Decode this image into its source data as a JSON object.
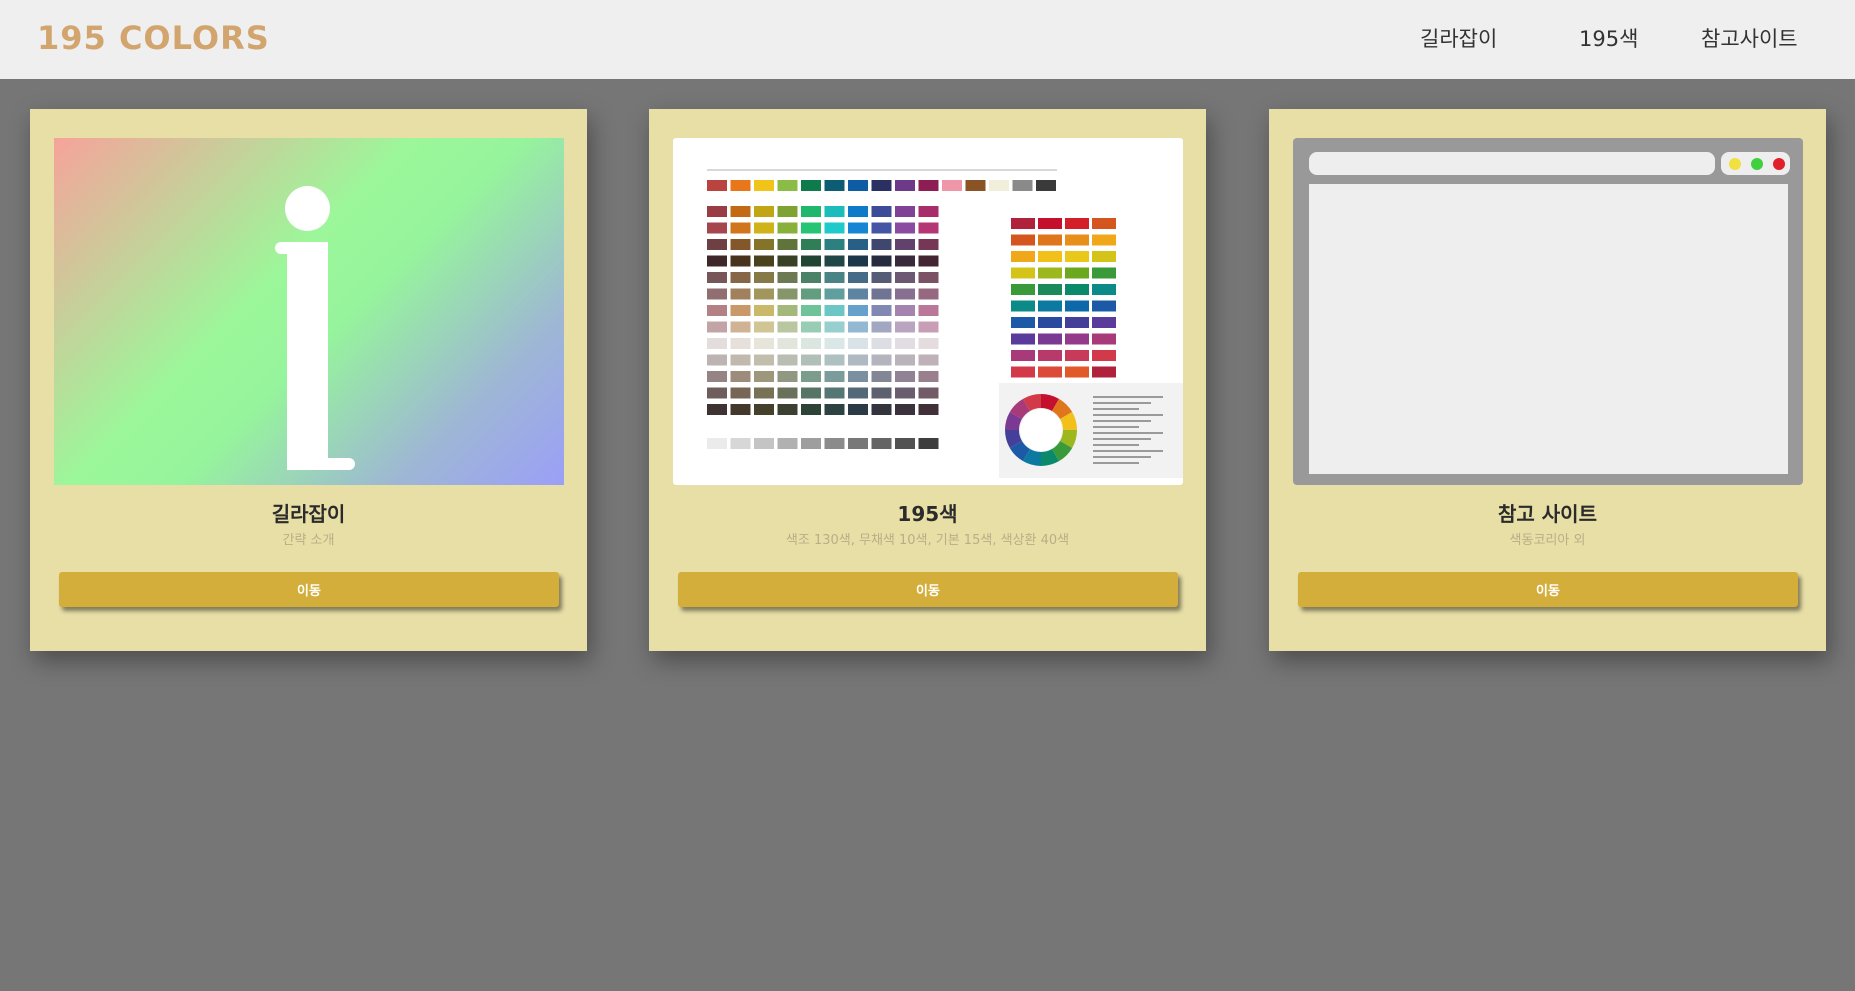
{
  "header": {
    "brand": "195 COLORS",
    "nav": [
      "길라잡이",
      "195색",
      "참고사이트"
    ]
  },
  "cards": [
    {
      "title": "길라잡이",
      "subtitle": "간략 소개",
      "button": "이동",
      "thumb": "info-icon"
    },
    {
      "title": "195색",
      "subtitle": "색조 130색, 무채색 10색, 기본 15색, 색상환 40색",
      "button": "이동",
      "thumb": "color-chart-image"
    },
    {
      "title": "참고 사이트",
      "subtitle": "색동코리아 외",
      "button": "이동",
      "thumb": "browser-window-icon"
    }
  ],
  "colors": {
    "topbar": "#efefef",
    "brand": "#d2a56e",
    "page_bg": "#767676",
    "card_bg": "#e8dfa6",
    "button": "#d4ae3b",
    "dot_yellow": "#f0e040",
    "dot_green": "#3fcf3f",
    "dot_red": "#e0202a"
  }
}
